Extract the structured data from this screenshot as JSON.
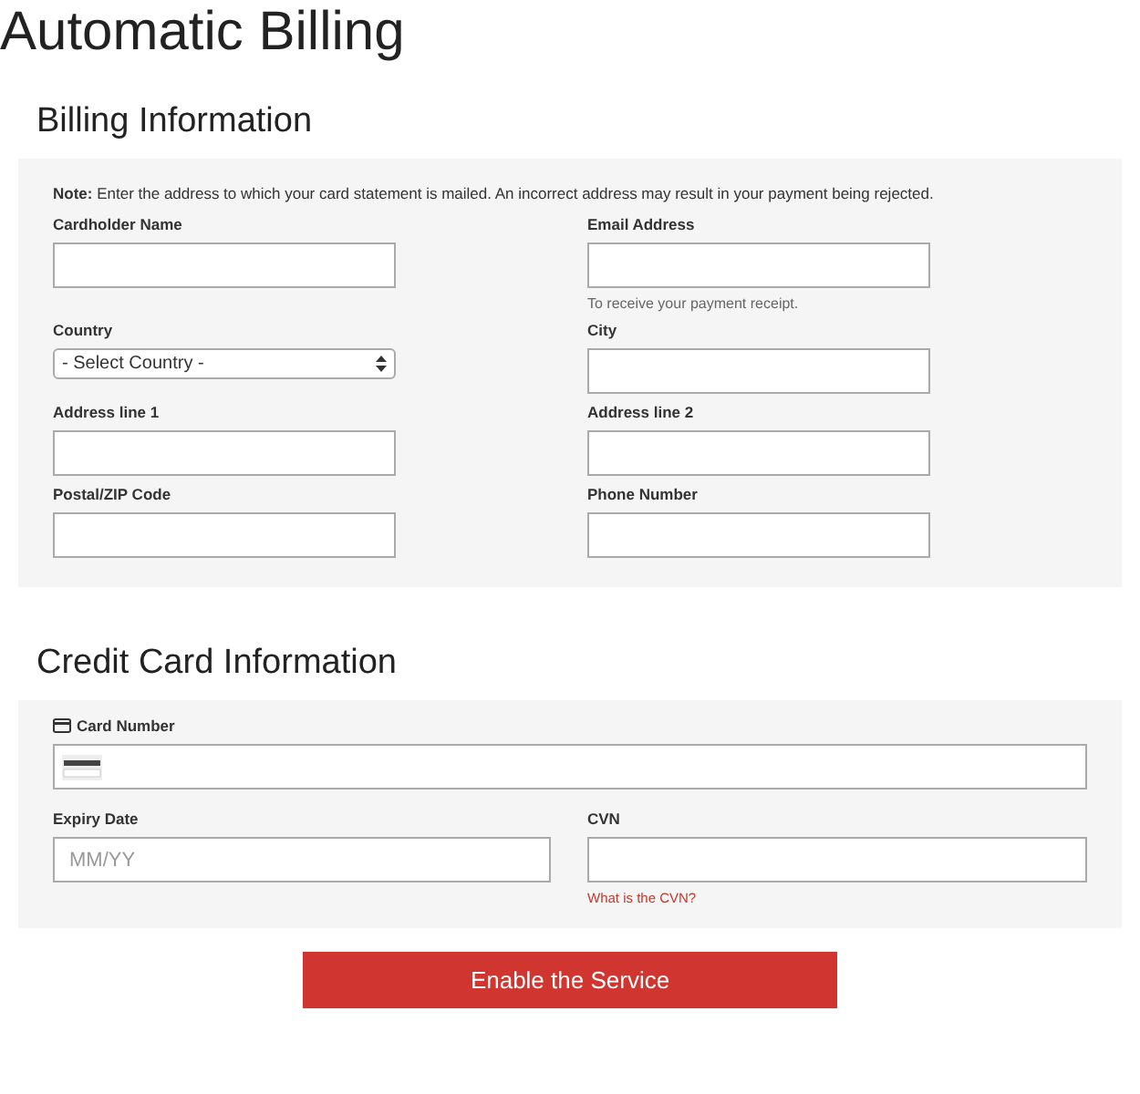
{
  "page_title": "Automatic Billing",
  "billing": {
    "title": "Billing Information",
    "note": "**Note:** Enter the address to which your card statement is mailed. An incorrect address may result in your payment being rejected.",
    "fields": [
      {
        "label": "Cardholder Name",
        "kind": "text"
      },
      {
        "label": "Email Address",
        "kind": "text",
        "hint": "To receive your payment receipt."
      },
      {
        "label": "Country",
        "kind": "select",
        "value": "- Select Country -"
      },
      {
        "label": "City",
        "kind": "text"
      },
      {
        "label": "Address line 1",
        "kind": "text"
      },
      {
        "label": "Address line 2",
        "kind": "text"
      },
      {
        "label": "Postal/ZIP Code",
        "kind": "text"
      },
      {
        "label": "Phone Number",
        "kind": "text"
      }
    ]
  },
  "credit_card": {
    "title": "Credit Card Information",
    "card_number": {
      "label": "Card Number"
    },
    "expiry": {
      "label": "Expiry Date",
      "placeholder": "MM/YY"
    },
    "cvn": {
      "label": "CVN",
      "link": "What is the CVN?"
    }
  },
  "submit_button": "Enable the Service"
}
